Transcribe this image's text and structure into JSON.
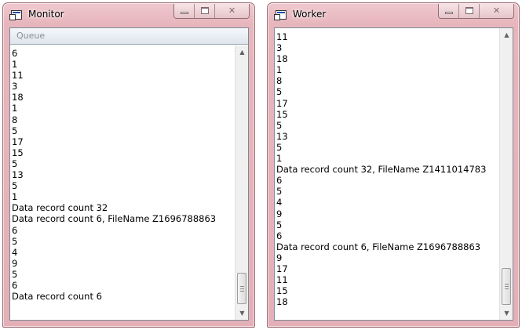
{
  "monitor": {
    "title": "Monitor",
    "tab_label": "Queue",
    "lines": [
      "6",
      "1",
      "11",
      "3",
      "18",
      "1",
      "8",
      "5",
      "17",
      "15",
      "5",
      "13",
      "5",
      "1",
      "Data record count 32",
      "Data record count 6, FileName Z1696788863",
      "6",
      "5",
      "4",
      "9",
      "5",
      "6",
      "Data record count 6"
    ],
    "icons": {
      "app": "app-window-icon",
      "minimize": "minimize-icon",
      "maximize": "maximize-icon",
      "close": "close-icon",
      "scroll_up": "scroll-up-arrow-icon",
      "scroll_down": "scroll-down-arrow-icon"
    }
  },
  "worker": {
    "title": "Worker",
    "lines": [
      "11",
      "3",
      "18",
      "1",
      "8",
      "5",
      "17",
      "15",
      "5",
      "13",
      "5",
      "1",
      "Data record count 32, FileName Z1411014783",
      "6",
      "5",
      "4",
      "9",
      "5",
      "6",
      "Data record count 6, FileName Z1696788863",
      "9",
      "17",
      "11",
      "15",
      "18"
    ],
    "icons": {
      "app": "app-window-icon",
      "minimize": "minimize-icon",
      "maximize": "maximize-icon",
      "close": "close-icon",
      "scroll_up": "scroll-up-arrow-icon",
      "scroll_down": "scroll-down-arrow-icon"
    }
  }
}
